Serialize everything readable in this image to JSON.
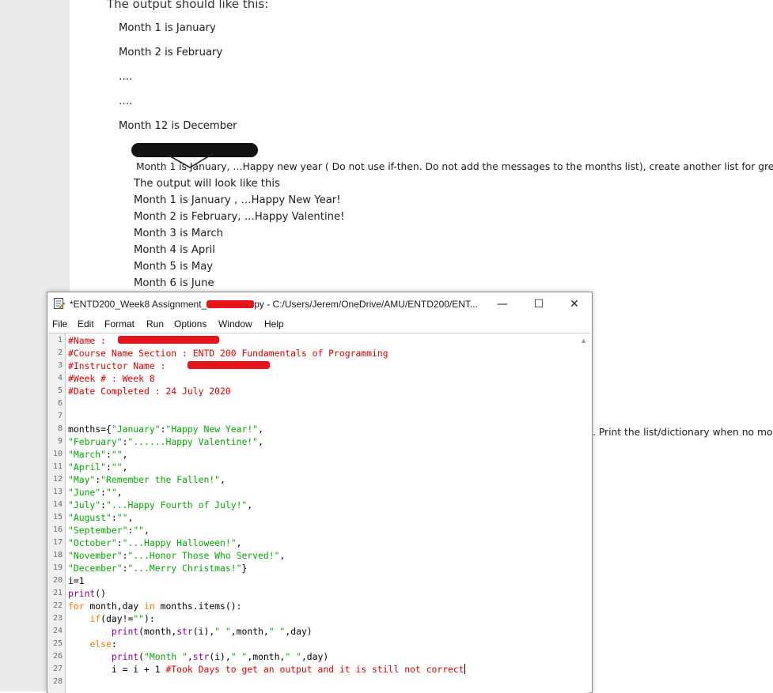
{
  "document": {
    "heading": "The output should like this:",
    "example_lines": [
      "Month 1  is  January",
      "Month 2 is  February",
      "….",
      "….",
      "Month 12 is December"
    ],
    "greeting_instruction": "Month 1 is January, …Happy new year ( Do not use if-then. Do not add the messages to the months list), create another list for greetings.",
    "greeting_intro": "The output will look like this",
    "greeting_lines": [
      "Month 1 is January , …Happy New Year!",
      "Month 2 is February,  …Happy Valentine!",
      "Month 3 is March",
      "Month 4 is April",
      "Month 5 is May",
      "Month 6 is June"
    ],
    "side_note": ". Print the list/dictionary when no more"
  },
  "idle_window": {
    "title": "*ENTD200_Week8 Assignment_",
    "title_suffix": "py - C:/Users/Jerem/OneDrive/AMU/ENTD200/ENT...",
    "minimize": "—",
    "maximize": "☐",
    "close": "✕",
    "menu": [
      "File",
      "Edit",
      "Format",
      "Run",
      "Options",
      "Window",
      "Help"
    ],
    "lines": [
      {
        "n": "1",
        "segs": [
          {
            "t": "#Name : ",
            "c": "comment"
          }
        ]
      },
      {
        "n": "2",
        "segs": [
          {
            "t": "#Course Name Section : ENTD 200 Fundamentals of Programming",
            "c": "comment"
          }
        ]
      },
      {
        "n": "3",
        "segs": [
          {
            "t": "#Instructor Name : ",
            "c": "comment"
          }
        ]
      },
      {
        "n": "4",
        "segs": [
          {
            "t": "#Week # : Week 8",
            "c": "comment"
          }
        ]
      },
      {
        "n": "5",
        "segs": [
          {
            "t": "#Date Completed : 24 July 2020",
            "c": "comment"
          }
        ]
      },
      {
        "n": "6",
        "segs": []
      },
      {
        "n": "7",
        "segs": []
      },
      {
        "n": "8",
        "segs": [
          {
            "t": "months={",
            "c": "plain"
          },
          {
            "t": "\"January\"",
            "c": "string"
          },
          {
            "t": ":",
            "c": "plain"
          },
          {
            "t": "\"Happy New Year!\"",
            "c": "string"
          },
          {
            "t": ",",
            "c": "plain"
          }
        ]
      },
      {
        "n": "9",
        "segs": [
          {
            "t": "\"February\"",
            "c": "string"
          },
          {
            "t": ":",
            "c": "plain"
          },
          {
            "t": "\"......Happy Valentine!\"",
            "c": "string"
          },
          {
            "t": ",",
            "c": "plain"
          }
        ]
      },
      {
        "n": "10",
        "segs": [
          {
            "t": "\"March\"",
            "c": "string"
          },
          {
            "t": ":",
            "c": "plain"
          },
          {
            "t": "\"\"",
            "c": "string"
          },
          {
            "t": ",",
            "c": "plain"
          }
        ]
      },
      {
        "n": "11",
        "segs": [
          {
            "t": "\"April\"",
            "c": "string"
          },
          {
            "t": ":",
            "c": "plain"
          },
          {
            "t": "\"\"",
            "c": "string"
          },
          {
            "t": ",",
            "c": "plain"
          }
        ]
      },
      {
        "n": "12",
        "segs": [
          {
            "t": "\"May\"",
            "c": "string"
          },
          {
            "t": ":",
            "c": "plain"
          },
          {
            "t": "\"Remember the Fallen!\"",
            "c": "string"
          },
          {
            "t": ",",
            "c": "plain"
          }
        ]
      },
      {
        "n": "13",
        "segs": [
          {
            "t": "\"June\"",
            "c": "string"
          },
          {
            "t": ":",
            "c": "plain"
          },
          {
            "t": "\"\"",
            "c": "string"
          },
          {
            "t": ",",
            "c": "plain"
          }
        ]
      },
      {
        "n": "14",
        "segs": [
          {
            "t": "\"July\"",
            "c": "string"
          },
          {
            "t": ":",
            "c": "plain"
          },
          {
            "t": "\"...Happy Fourth of July!\"",
            "c": "string"
          },
          {
            "t": ",",
            "c": "plain"
          }
        ]
      },
      {
        "n": "15",
        "segs": [
          {
            "t": "\"August\"",
            "c": "string"
          },
          {
            "t": ":",
            "c": "plain"
          },
          {
            "t": "\"\"",
            "c": "string"
          },
          {
            "t": ",",
            "c": "plain"
          }
        ]
      },
      {
        "n": "16",
        "segs": [
          {
            "t": "\"September\"",
            "c": "string"
          },
          {
            "t": ":",
            "c": "plain"
          },
          {
            "t": "\"\"",
            "c": "string"
          },
          {
            "t": ",",
            "c": "plain"
          }
        ]
      },
      {
        "n": "17",
        "segs": [
          {
            "t": "\"October\"",
            "c": "string"
          },
          {
            "t": ":",
            "c": "plain"
          },
          {
            "t": "\"...Happy Halloween!\"",
            "c": "string"
          },
          {
            "t": ",",
            "c": "plain"
          }
        ]
      },
      {
        "n": "18",
        "segs": [
          {
            "t": "\"November\"",
            "c": "string"
          },
          {
            "t": ":",
            "c": "plain"
          },
          {
            "t": "\"...Honor Those Who Served!\"",
            "c": "string"
          },
          {
            "t": ",",
            "c": "plain"
          }
        ]
      },
      {
        "n": "19",
        "segs": [
          {
            "t": "\"December\"",
            "c": "string"
          },
          {
            "t": ":",
            "c": "plain"
          },
          {
            "t": "\"...Merry Christmas!\"",
            "c": "string"
          },
          {
            "t": "}",
            "c": "plain"
          }
        ]
      },
      {
        "n": "20",
        "segs": [
          {
            "t": "i=1",
            "c": "plain"
          }
        ]
      },
      {
        "n": "21",
        "segs": [
          {
            "t": "print",
            "c": "builtin"
          },
          {
            "t": "()",
            "c": "plain"
          }
        ]
      },
      {
        "n": "22",
        "segs": [
          {
            "t": "for",
            "c": "keyword"
          },
          {
            "t": " month,day ",
            "c": "plain"
          },
          {
            "t": "in",
            "c": "keyword"
          },
          {
            "t": " months.items():",
            "c": "plain"
          }
        ]
      },
      {
        "n": "23",
        "segs": [
          {
            "t": "    ",
            "c": "plain"
          },
          {
            "t": "if",
            "c": "keyword"
          },
          {
            "t": "(day!=",
            "c": "plain"
          },
          {
            "t": "\"\"",
            "c": "string"
          },
          {
            "t": "):",
            "c": "plain"
          }
        ]
      },
      {
        "n": "24",
        "segs": [
          {
            "t": "        ",
            "c": "plain"
          },
          {
            "t": "print",
            "c": "builtin"
          },
          {
            "t": "(month,",
            "c": "plain"
          },
          {
            "t": "str",
            "c": "builtin"
          },
          {
            "t": "(i),",
            "c": "plain"
          },
          {
            "t": "\" \"",
            "c": "string"
          },
          {
            "t": ",month,",
            "c": "plain"
          },
          {
            "t": "\" \"",
            "c": "string"
          },
          {
            "t": ",day)",
            "c": "plain"
          }
        ]
      },
      {
        "n": "25",
        "segs": [
          {
            "t": "    ",
            "c": "plain"
          },
          {
            "t": "else",
            "c": "keyword"
          },
          {
            "t": ":",
            "c": "plain"
          }
        ]
      },
      {
        "n": "26",
        "segs": [
          {
            "t": "        ",
            "c": "plain"
          },
          {
            "t": "print",
            "c": "builtin"
          },
          {
            "t": "(",
            "c": "plain"
          },
          {
            "t": "\"Month \"",
            "c": "string"
          },
          {
            "t": ",",
            "c": "plain"
          },
          {
            "t": "str",
            "c": "builtin"
          },
          {
            "t": "(i),",
            "c": "plain"
          },
          {
            "t": "\" \"",
            "c": "string"
          },
          {
            "t": ",month,",
            "c": "plain"
          },
          {
            "t": "\" \"",
            "c": "string"
          },
          {
            "t": ",day)",
            "c": "plain"
          }
        ]
      },
      {
        "n": "27",
        "segs": [
          {
            "t": "        i = i + 1 ",
            "c": "plain"
          },
          {
            "t": "#Took Days to get an output and it is still not correct",
            "c": "comment"
          }
        ]
      },
      {
        "n": "28",
        "segs": []
      }
    ]
  },
  "colors": {
    "comment": "#dd0000",
    "string": "#00aa00",
    "keyword": "#ff7700",
    "builtin": "#900090",
    "redaction": "#e8141c"
  }
}
